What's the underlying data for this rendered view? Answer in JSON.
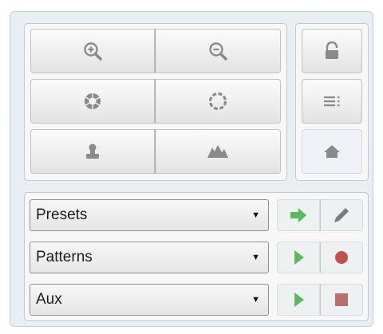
{
  "colors": {
    "panel_bg": "#e9eef3",
    "icon_gray": "#8a8a8a",
    "play_green": "#5cb85c",
    "record_red": "#c0504d"
  },
  "view_controls": {
    "icons": [
      "zoom-in-icon",
      "zoom-out-icon",
      "iris-open-icon",
      "iris-close-icon",
      "focus-near-icon",
      "focus-far-icon"
    ]
  },
  "side_controls": {
    "icons": [
      "lock-icon",
      "menu-list-icon",
      "home-icon"
    ]
  },
  "selectors": [
    {
      "id": "presets",
      "value": "Presets",
      "actions": [
        "go-arrow-icon",
        "edit-pencil-icon"
      ]
    },
    {
      "id": "patterns",
      "value": "Patterns",
      "actions": [
        "play-icon",
        "record-icon"
      ]
    },
    {
      "id": "aux",
      "value": "Aux",
      "actions": [
        "play-icon",
        "stop-icon"
      ]
    }
  ]
}
